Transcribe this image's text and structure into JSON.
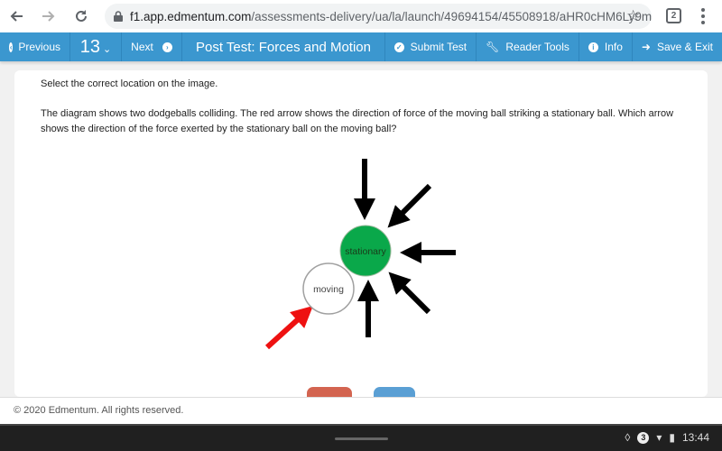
{
  "browser": {
    "url_host": "f1.app.edmentum.com",
    "url_path": "/assessments-delivery/ua/la/launch/49694154/45508918/aHR0cHM6Ly9mMS5hc...",
    "tab_count": "2",
    "icons": [
      "back-arrow-icon",
      "forward-arrow-icon",
      "reload-icon",
      "lock-icon",
      "star-icon",
      "tabs-icon",
      "menu-icon"
    ]
  },
  "header": {
    "previous_label": "Previous",
    "question_number": "13",
    "next_label": "Next",
    "title": "Post Test: Forces and Motion",
    "submit_label": "Submit Test",
    "reader_tools_label": "Reader Tools",
    "info_label": "Info",
    "save_exit_label": "Save & Exit",
    "accent_color": "#3b97cf"
  },
  "question": {
    "instruction": "Select the correct location on the image.",
    "text": "The diagram shows two dodgeballs colliding. The red arrow shows the direction of force of the moving ball striking a stationary ball. Which arrow shows the direction of the force exerted by the stationary ball on the moving ball?"
  },
  "diagram": {
    "stationary_label": "stationary",
    "moving_label": "moving",
    "stationary_color": "#0aa84a",
    "force_arrow_color": "#ee1111",
    "answer_arrows": [
      "top-down",
      "top-right-diagonal",
      "right-horizontal",
      "bottom-right-diagonal",
      "bottom-up"
    ]
  },
  "footer": {
    "copyright": "© 2020 Edmentum. All rights reserved."
  },
  "system_bar": {
    "notification_count": "3",
    "time": "13:44"
  }
}
